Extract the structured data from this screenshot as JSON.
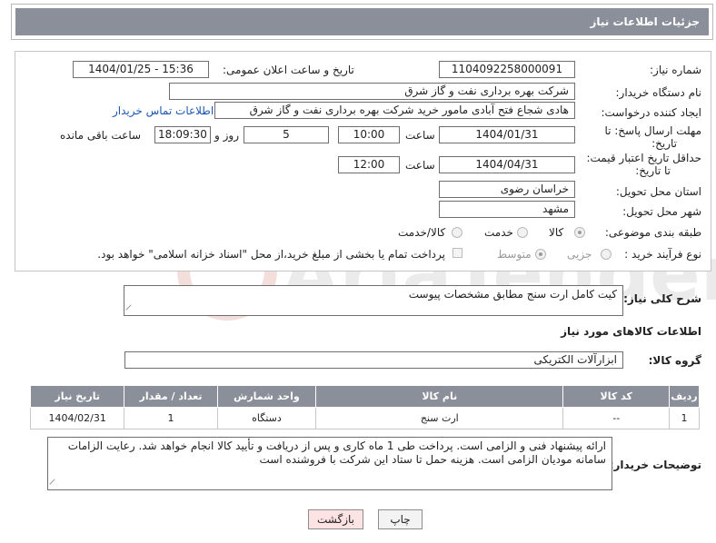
{
  "header": {
    "title": "جزئیات اطلاعات نیاز"
  },
  "form": {
    "need_number_label": "شماره نیاز:",
    "need_number": "1104092258000091",
    "announce_label": "تاریخ و ساعت اعلان عمومی:",
    "announce_value": "1404/01/25 - 15:36",
    "buyer_org_label": "نام دستگاه خریدار:",
    "buyer_org": "شرکت بهره برداری نفت و گاز شرق",
    "creator_label": "ایجاد کننده درخواست:",
    "creator": "هادی شجاع فتح آبادی مامور خرید شرکت بهره برداری نفت و گاز شرق",
    "contact_link": "اطلاعات تماس خریدار",
    "deadline_label_1": "مهلت ارسال پاسخ: تا",
    "deadline_label_2": "تاریخ:",
    "deadline_date": "1404/01/31",
    "time_label": "ساعت",
    "deadline_time": "10:00",
    "days_value": "5",
    "days_label": "روز و",
    "remaining_time": "18:09:30",
    "remaining_label": "ساعت باقی مانده",
    "validity_label_1": "حداقل تاریخ اعتبار قیمت:",
    "validity_label_2": "تا تاریخ:",
    "validity_date": "1404/04/31",
    "validity_time": "12:00",
    "province_label": "استان محل تحویل:",
    "province": "خراسان رضوی",
    "city_label": "شهر محل تحویل:",
    "city": "مشهد",
    "category_label": "طبقه بندی موضوعی:",
    "category_options": [
      "کالا",
      "خدمت",
      "کالا/خدمت"
    ],
    "category_selected": "کالا",
    "process_label": "نوع فرآیند خرید :",
    "process_options": [
      "جزیی",
      "متوسط"
    ],
    "process_note": "پرداخت تمام یا بخشی از مبلغ خرید،از محل \"اسناد خزانه اسلامی\" خواهد بود."
  },
  "description": {
    "label": "شرح کلی نیاز:",
    "value": "کیت کامل ارت سنج مطابق مشخصات پیوست"
  },
  "goods_section": {
    "title": "اطلاعات کالاهای مورد نیاز",
    "group_label": "گروه کالا:",
    "group_value": "ابزارآلات الکتریکی"
  },
  "table": {
    "headers": [
      "ردیف",
      "کد کالا",
      "نام کالا",
      "واحد شمارش",
      "تعداد / مقدار",
      "تاریخ نیاز"
    ],
    "rows": [
      [
        "1",
        "--",
        "ارت سنج",
        "دستگاه",
        "1",
        "1404/02/31"
      ]
    ]
  },
  "buyer_notes": {
    "label": "توضیحات خریدار:",
    "value": "ارائه پیشنهاد فنی و الزامی است. پرداخت طی  1 ماه کاری و پس از دریافت و تأیید کالا انجام خواهد شد. رعایت الزامات سامانه مودیان الزامی است. هزینه حمل تا ستاد این شرکت با فروشنده است"
  },
  "buttons": {
    "print": "چاپ",
    "back": "بازگشت"
  },
  "watermark": {
    "text": "AriaTender.neT"
  },
  "colors": {
    "header_bg": "#8a8f99",
    "link": "#1a56b0",
    "back_btn_bg": "#fde3e3"
  }
}
